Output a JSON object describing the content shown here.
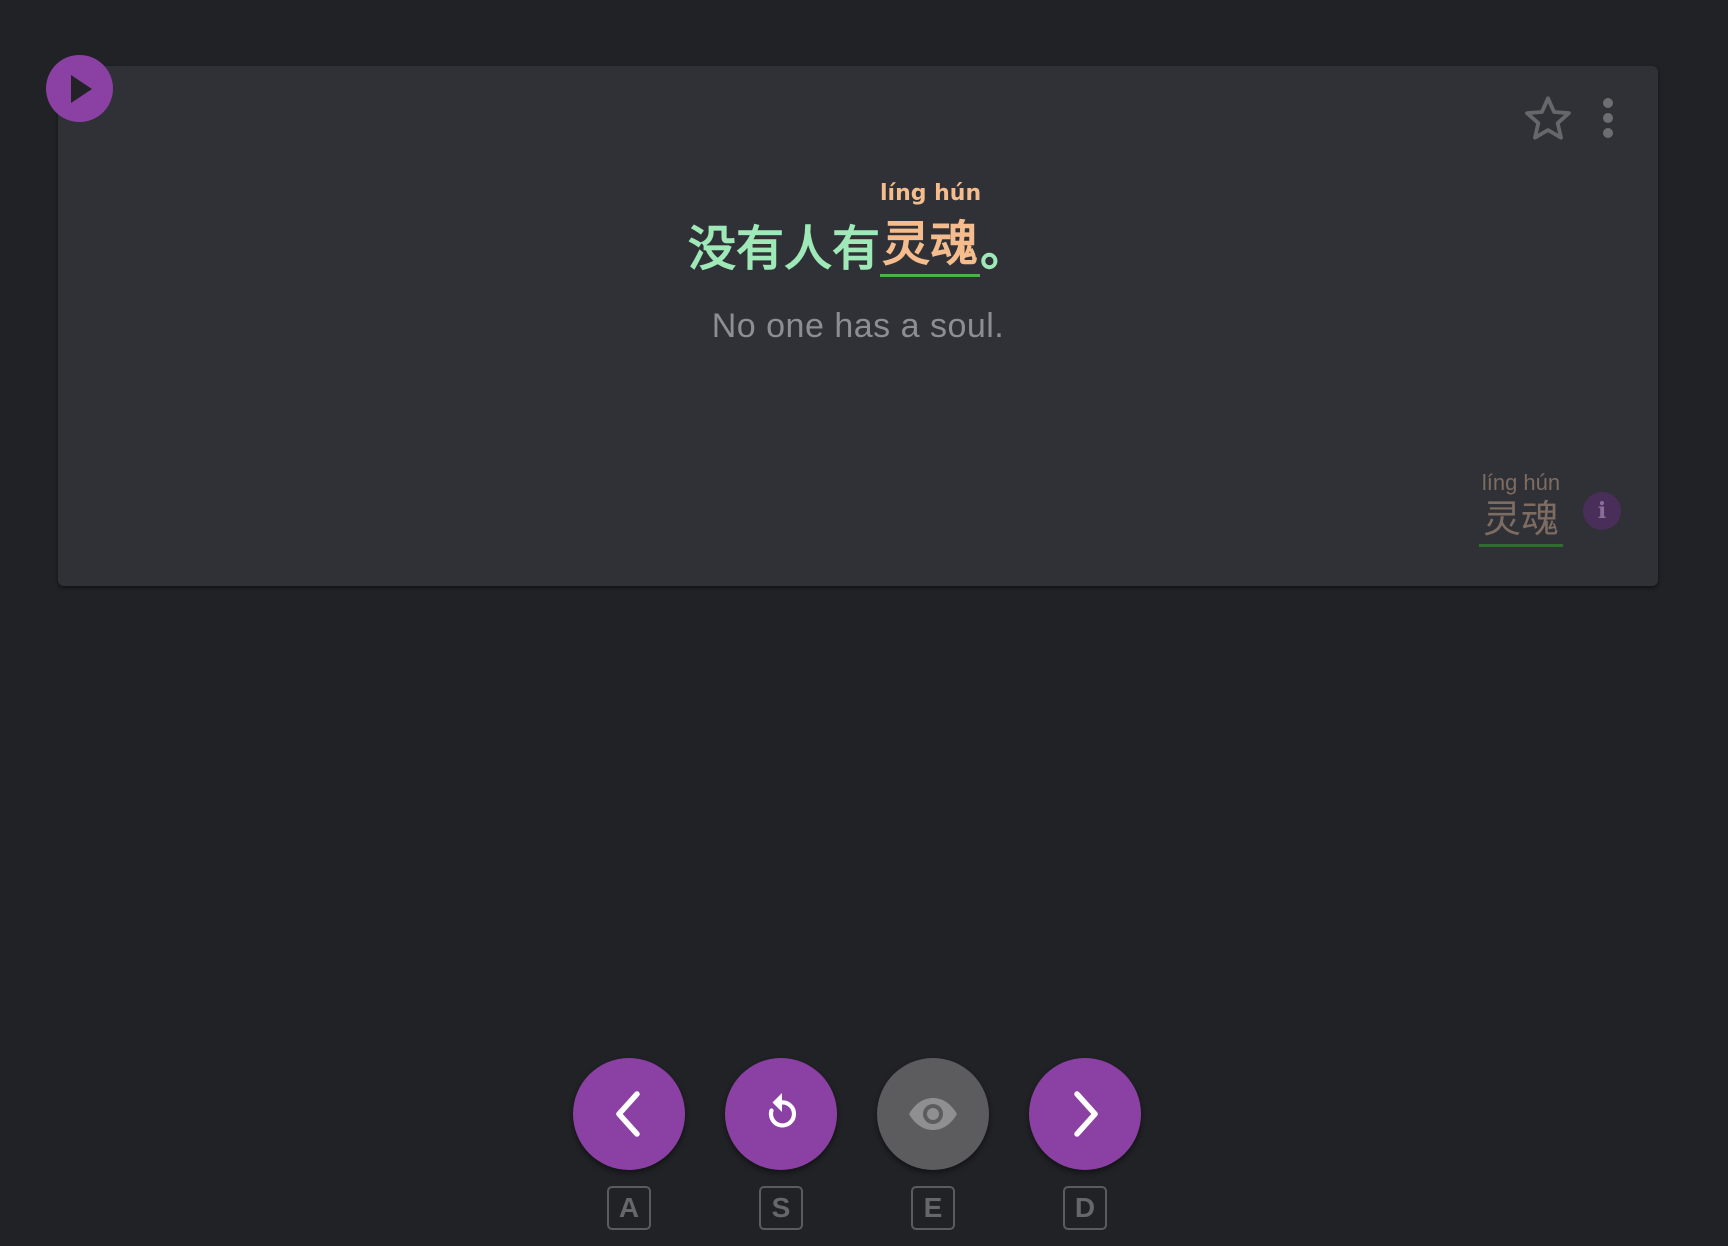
{
  "player": {
    "play_icon": "play-icon"
  },
  "card": {
    "star_icon": "star-outline-icon",
    "more_icon": "more-vertical-icon",
    "sentence": {
      "before": "没有人有",
      "target": "灵魂",
      "target_pinyin": "líng hún",
      "after": "。"
    },
    "translation": "No one has a soul.",
    "vocab": {
      "pinyin": "líng hún",
      "word": "灵魂"
    },
    "info_label": "i"
  },
  "controls": [
    {
      "name": "previous",
      "icon": "chevron-left-icon",
      "key": "A",
      "enabled": true
    },
    {
      "name": "replay",
      "icon": "replay-icon",
      "key": "S",
      "enabled": true
    },
    {
      "name": "reveal",
      "icon": "eye-icon",
      "key": "E",
      "enabled": false
    },
    {
      "name": "next",
      "icon": "chevron-right-icon",
      "key": "D",
      "enabled": true
    }
  ],
  "colors": {
    "accent": "#8a41a3",
    "sentence_text": "#9fe9b8",
    "target_text": "#f5bd8d",
    "target_underline": "#46b546",
    "background": "#212226",
    "card": "#303136"
  }
}
